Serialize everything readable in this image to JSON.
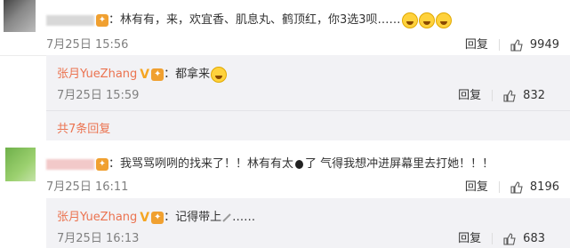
{
  "comments": [
    {
      "text": "：林有有，来，欢宜香、肌息丸、鹤顶红，你3选3呗……",
      "time": "7月25日 15:56",
      "reply_label": "回复",
      "likes": "9949"
    },
    {
      "text": "：我骂骂咧咧的找来了！！林有有太",
      "text2": "了 气得我想冲进屏幕里去打她！！！",
      "time": "7月25日 16:11",
      "reply_label": "回复",
      "likes": "8196"
    }
  ],
  "replies": [
    {
      "name": "张月YueZhang",
      "text": "：都拿来",
      "time": "7月25日 15:59",
      "reply_label": "回复",
      "likes": "832"
    },
    {
      "name": "张月YueZhang",
      "text": "：记得带上",
      "text_tail": "……",
      "time": "7月25日 16:13",
      "reply_label": "回复",
      "likes": "683"
    }
  ],
  "more_replies": "共7条回复",
  "icons": [
    "vip-badge-icon",
    "verified-v-icon",
    "laugh-cry-emoji-icon",
    "thumb-up-icon",
    "bomb-icon",
    "pen-icon"
  ],
  "colors": {
    "name": "#eb7350",
    "verified": "#f5a623",
    "time": "#808080",
    "reply_bg": "#f2f2f5"
  }
}
